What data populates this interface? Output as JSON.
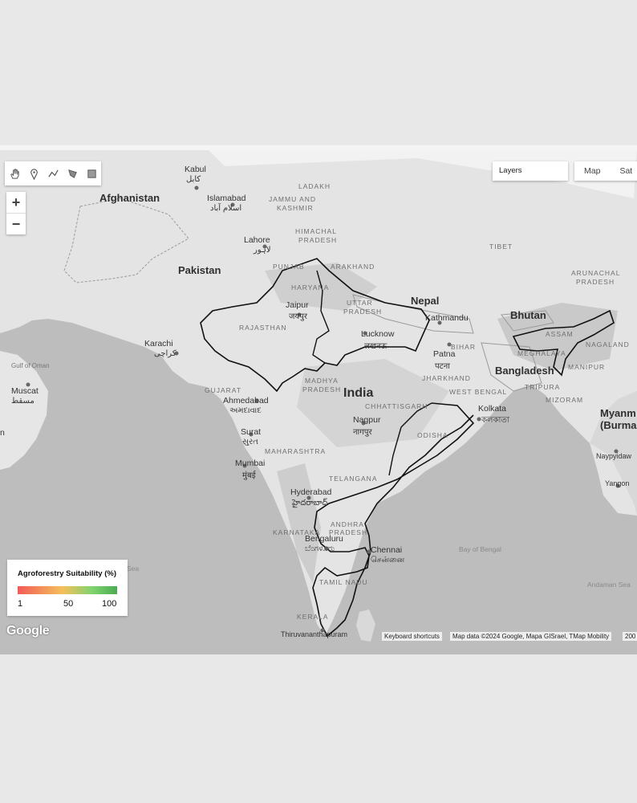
{
  "toolbar": {
    "tools": [
      {
        "name": "hand-icon"
      },
      {
        "name": "marker-icon"
      },
      {
        "name": "polyline-icon"
      },
      {
        "name": "polygon-icon"
      },
      {
        "name": "rectangle-icon"
      }
    ]
  },
  "zoom": {
    "in_label": "+",
    "out_label": "−"
  },
  "layers": {
    "label": "Layers"
  },
  "map_type": {
    "options": [
      "Map",
      "Sat"
    ]
  },
  "legend": {
    "title": "Agroforestry Suitability (%)",
    "ticks": [
      "1",
      "50",
      "100"
    ],
    "colors": [
      "#f25b57",
      "#f4c05c",
      "#7fd46f",
      "#4caa50"
    ]
  },
  "labels": {
    "countries": {
      "afghanistan": "Afghanistan",
      "pakistan": "Pakistan",
      "nepal": "Nepal",
      "bhutan": "Bhutan",
      "bangladesh": "Bangladesh",
      "india": "India",
      "myanmar": "Myanm (Burma",
      "tibet": "TIBET"
    },
    "states": {
      "ladakh": "LADAKH",
      "jk1": "JAMMU AND",
      "jk2": "KASHMIR",
      "hp1": "HIMACHAL",
      "hp2": "PRADESH",
      "punjab": "PUNJAB",
      "uttarakhand": "ARAKHAND",
      "haryana": "HARYANA",
      "up1": "UTTAR",
      "up2": "PRADESH",
      "rajasthan": "RAJASTHAN",
      "bihar": "BIHAR",
      "jharkhand": "JHARKHAND",
      "westbengal": "WEST BENGAL",
      "mp1": "MADHYA",
      "mp2": "PRADESH",
      "gujarat": "GUJARAT",
      "chhattisgarh": "CHHATTISGARH",
      "odisha": "ODISHA",
      "maharashtra": "MAHARASHTRA",
      "telangana": "TELANGANA",
      "ap1": "ANDHRA",
      "ap2": "PRADESH",
      "karnataka": "KARNATAKA",
      "tamilnadu": "TAMIL NADU",
      "kerala": "KERALA",
      "arunachal1": "ARUNACHAL",
      "arunachal2": "PRADESH",
      "assam": "ASSAM",
      "meghalaya": "MEGHALAYA",
      "nagaland": "NAGALAND",
      "manipur": "MANIPUR",
      "tripura": "TRIPURA",
      "mizoram": "MIZORAM"
    },
    "cities": {
      "kabul": "Kabul",
      "kabul_script": "کابل",
      "islamabad": "Islamabad",
      "islamabad_script": "اسلام آباد",
      "lahore": "Lahore",
      "lahore_script": "لاہور",
      "jaipur": "Jaipur",
      "jaipur_script": "जयपुर",
      "karachi": "Karachi",
      "karachi_script": "کراچی",
      "lucknow": "Lucknow",
      "lucknow_script": "लखनऊ",
      "kathmandu": "Kathmandu",
      "patna": "Patna",
      "patna_script": "पटना",
      "muscat": "Muscat",
      "muscat_script": "مسقط",
      "ahmedabad": "Ahmedabad",
      "ahmedabad_script": "અમદાવાદ",
      "kolkata": "Kolkata",
      "kolkata_script": "কলকাতা",
      "surat": "Surat",
      "surat_script": "સુરત",
      "nagpur": "Nagpur",
      "nagpur_script": "नागपुर",
      "mumbai": "Mumbai",
      "mumbai_script": "मुंबई",
      "hyderabad": "Hyderabad",
      "hyderabad_script": "హైదరాబాద్",
      "bengaluru": "Bengaluru",
      "bengaluru_script": "ಬೆಂಗಳೂರು",
      "chennai": "Chennai",
      "chennai_script": "சென்னை",
      "thiruvananthapuram": "Thiruvananthapuram",
      "naypyidaw": "Naypyidaw",
      "yangon": "Yangon"
    },
    "water": {
      "gulf_oman1": "Gulf of Oman",
      "bay_bengal": "Bay of Bengal",
      "andaman": "Andaman Sea",
      "sea": "Sea"
    },
    "edge_n": "n"
  },
  "footer": {
    "logo": "Google",
    "shortcuts": "Keyboard shortcuts",
    "attribution": "Map data ©2024 Google, Mapa GISrael, TMap Mobility",
    "more": "200"
  }
}
